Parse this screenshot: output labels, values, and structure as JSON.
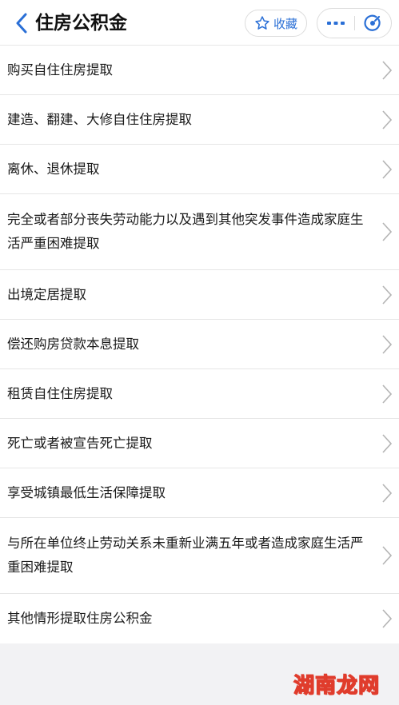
{
  "header": {
    "title": "住房公积金",
    "favorite_label": "收藏",
    "accent": "#2a6fd6"
  },
  "items": [
    {
      "label": "购买自住住房提取"
    },
    {
      "label": "建造、翻建、大修自住住房提取"
    },
    {
      "label": "离休、退休提取"
    },
    {
      "label": "完全或者部分丧失劳动能力以及遇到其他突发事件造成家庭生活严重困难提取"
    },
    {
      "label": "出境定居提取"
    },
    {
      "label": "偿还购房贷款本息提取"
    },
    {
      "label": "租赁自住住房提取"
    },
    {
      "label": "死亡或者被宣告死亡提取"
    },
    {
      "label": "享受城镇最低生活保障提取"
    },
    {
      "label": "与所在单位终止劳动关系未重新业满五年或者造成家庭生活严重困难提取"
    },
    {
      "label": "其他情形提取住房公积金"
    }
  ],
  "watermark": "湖南龙网"
}
